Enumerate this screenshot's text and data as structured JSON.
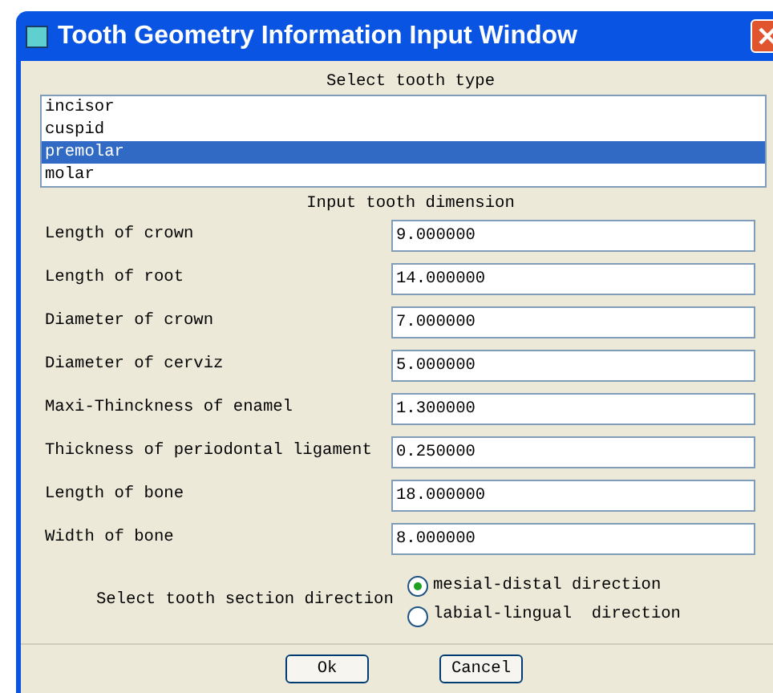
{
  "window": {
    "title": "Tooth Geometry Information Input Window"
  },
  "tooth_type": {
    "heading": "Select tooth type",
    "items": [
      {
        "label": "incisor",
        "selected": false
      },
      {
        "label": "cuspid",
        "selected": false
      },
      {
        "label": "premolar",
        "selected": true
      },
      {
        "label": "molar",
        "selected": false
      }
    ]
  },
  "dimensions": {
    "heading": "Input tooth dimension",
    "fields": [
      {
        "label": "Length of crown",
        "value": "9.000000"
      },
      {
        "label": "Length of root",
        "value": "14.000000"
      },
      {
        "label": "Diameter of crown",
        "value": "7.000000"
      },
      {
        "label": "Diameter of cerviz",
        "value": "5.000000"
      },
      {
        "label": "Maxi-Thinckness of enamel",
        "value": "1.300000"
      },
      {
        "label": "Thickness of periodontal ligament",
        "value": "0.250000"
      },
      {
        "label": "Length of bone",
        "value": "18.000000"
      },
      {
        "label": "Width of bone",
        "value": "8.000000"
      }
    ]
  },
  "section_direction": {
    "label": "Select tooth section direction",
    "options": [
      {
        "label": "mesial-distal direction",
        "selected": true
      },
      {
        "label": "labial-lingual  direction",
        "selected": false
      }
    ]
  },
  "buttons": [
    "Ok",
    "Cancel"
  ]
}
